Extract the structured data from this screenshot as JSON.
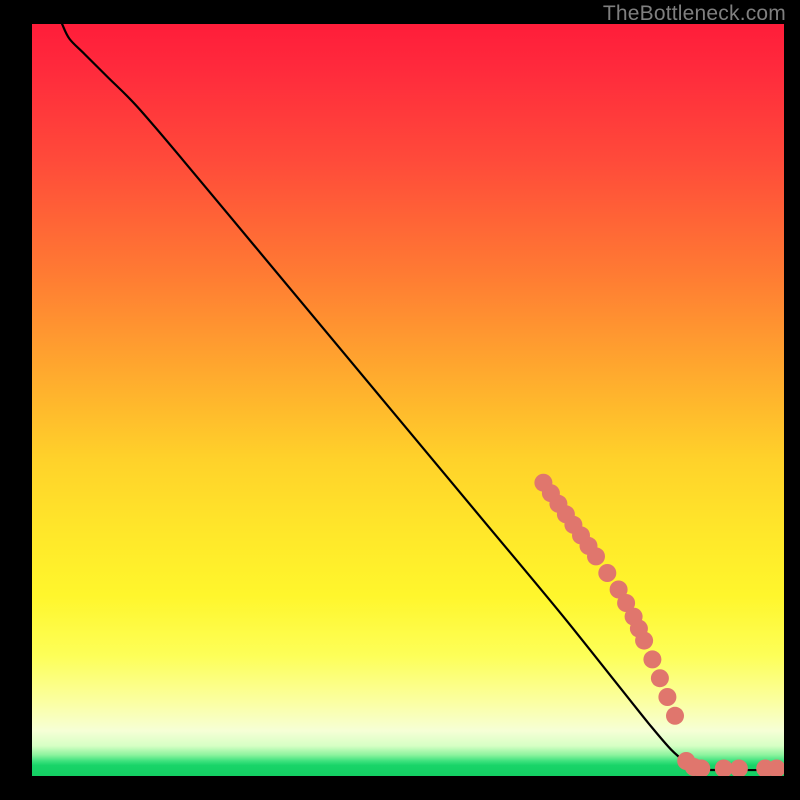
{
  "attribution": "TheBottleneck.com",
  "chart_data": {
    "type": "line",
    "title": "",
    "xlabel": "",
    "ylabel": "",
    "xlim": [
      0,
      100
    ],
    "ylim": [
      0,
      100
    ],
    "grid": false,
    "curve_note": "Decreasing curve from top-left to bottom-right then flat along bottom. Values are estimates read off an unlabeled plot area; axes shown as 0–100 fractions of the plot box.",
    "curve": [
      {
        "x": 4,
        "y": 100
      },
      {
        "x": 5,
        "y": 98
      },
      {
        "x": 7,
        "y": 96
      },
      {
        "x": 10,
        "y": 93
      },
      {
        "x": 14,
        "y": 89
      },
      {
        "x": 20,
        "y": 82
      },
      {
        "x": 30,
        "y": 70
      },
      {
        "x": 40,
        "y": 58
      },
      {
        "x": 50,
        "y": 46
      },
      {
        "x": 60,
        "y": 34
      },
      {
        "x": 70,
        "y": 22
      },
      {
        "x": 78,
        "y": 12
      },
      {
        "x": 82,
        "y": 7
      },
      {
        "x": 85,
        "y": 3.5
      },
      {
        "x": 87,
        "y": 1.8
      },
      {
        "x": 88.5,
        "y": 1.0
      },
      {
        "x": 90,
        "y": 0.8
      },
      {
        "x": 100,
        "y": 0.8
      }
    ],
    "marker_series": {
      "name": "highlighted-points",
      "color": "#e0766d",
      "radius_px": 9,
      "points": [
        {
          "x": 68.0,
          "y": 39.0
        },
        {
          "x": 69.0,
          "y": 37.6
        },
        {
          "x": 70.0,
          "y": 36.2
        },
        {
          "x": 71.0,
          "y": 34.8
        },
        {
          "x": 72.0,
          "y": 33.4
        },
        {
          "x": 73.0,
          "y": 32.0
        },
        {
          "x": 74.0,
          "y": 30.6
        },
        {
          "x": 75.0,
          "y": 29.2
        },
        {
          "x": 76.5,
          "y": 27.0
        },
        {
          "x": 78.0,
          "y": 24.8
        },
        {
          "x": 79.0,
          "y": 23.0
        },
        {
          "x": 80.0,
          "y": 21.2
        },
        {
          "x": 80.7,
          "y": 19.6
        },
        {
          "x": 81.4,
          "y": 18.0
        },
        {
          "x": 82.5,
          "y": 15.5
        },
        {
          "x": 83.5,
          "y": 13.0
        },
        {
          "x": 84.5,
          "y": 10.5
        },
        {
          "x": 85.5,
          "y": 8.0
        },
        {
          "x": 87.0,
          "y": 2.0
        },
        {
          "x": 88.0,
          "y": 1.2
        },
        {
          "x": 89.0,
          "y": 1.0
        },
        {
          "x": 92.0,
          "y": 1.0
        },
        {
          "x": 94.0,
          "y": 1.0
        },
        {
          "x": 97.5,
          "y": 1.0
        },
        {
          "x": 99.0,
          "y": 1.0
        }
      ]
    }
  }
}
